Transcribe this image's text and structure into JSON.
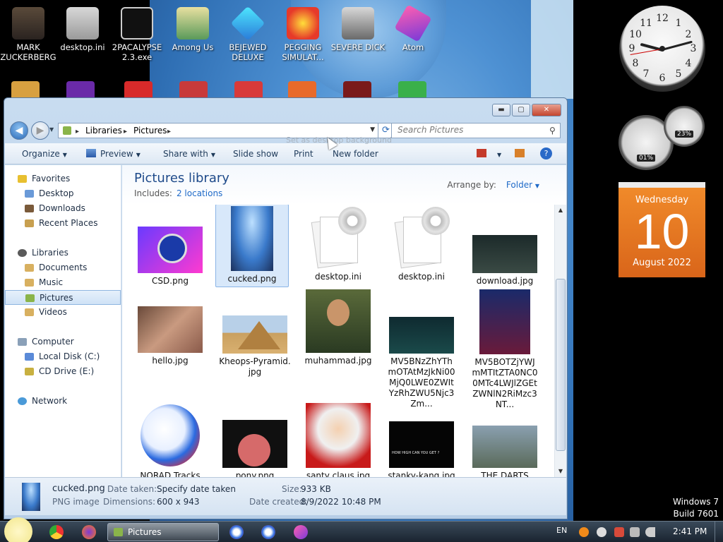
{
  "desktop": {
    "icons": [
      {
        "label": "MARK ZUCKERBERG"
      },
      {
        "label": "desktop.ini"
      },
      {
        "label": "2PACALYPSE 2.3.exe"
      },
      {
        "label": "Among Us"
      },
      {
        "label": "BEJEWED DELUXE"
      },
      {
        "label": "PEGGING SIMULAT..."
      },
      {
        "label": "SEVERE DICK"
      },
      {
        "label": "Atom"
      }
    ],
    "clock_numbers": [
      "12",
      "1",
      "2",
      "3",
      "4",
      "5",
      "6",
      "7",
      "8",
      "9",
      "10",
      "11"
    ],
    "meters": {
      "cpu": "01%",
      "memory": "23%"
    },
    "calendar": {
      "weekday": "Wednesday",
      "day": "10",
      "month_year": "August 2022"
    },
    "os": {
      "line1": "Windows 7",
      "line2": "Build 7601"
    }
  },
  "window": {
    "controls": {
      "minimize": "▬",
      "maximize": "▢",
      "close": "✕"
    },
    "breadcrumb": [
      "Libraries",
      "Pictures"
    ],
    "search_placeholder": "Search Pictures",
    "ghost_tooltip": "Set as desktop background",
    "toolbar": {
      "organize": "Organize",
      "preview": "Preview",
      "share_with": "Share with",
      "slide_show": "Slide show",
      "print": "Print",
      "new_folder": "New folder"
    },
    "sidebar": {
      "favorites": "Favorites",
      "desktop": "Desktop",
      "downloads": "Downloads",
      "recent_places": "Recent Places",
      "libraries": "Libraries",
      "documents": "Documents",
      "music": "Music",
      "pictures": "Pictures",
      "videos": "Videos",
      "computer": "Computer",
      "local_disk": "Local Disk (C:)",
      "cd_drive": "CD Drive (E:)",
      "network": "Network"
    },
    "library": {
      "title": "Pictures library",
      "includes_label": "Includes:",
      "includes_link": "2 locations",
      "arrange_label": "Arrange by:",
      "arrange_value": "Folder"
    },
    "files": [
      "CSD.png",
      "cucked.png",
      "desktop.ini",
      "desktop.ini",
      "download.jpg",
      "hello.jpg",
      "Kheops-Pyramid.jpg",
      "muhammad.jpg",
      "MV5BNzZhYThmOTAtMzJkNi00MjQ0LWE0ZWItYzRhZWU5Njc3Zm...",
      "MV5BOTZjYWJmMTItZTA0NC00MTc4LWJlZGEtZWNlN2RiMzc3NT...",
      "NORAD Tracks",
      "pony.png",
      "santy claus.jpg",
      "stanky-kang.jpg",
      "THE DARTS"
    ],
    "details": {
      "name": "cucked.png",
      "type": "PNG image",
      "date_taken_label": "Date taken:",
      "date_taken_value": "Specify date taken",
      "dimensions_label": "Dimensions:",
      "dimensions_value": "600 x 943",
      "size_label": "Size:",
      "size_value": "933 KB",
      "date_created_label": "Date created:",
      "date_created_value": "8/9/2022 10:48 PM"
    }
  },
  "taskbar": {
    "active_window": "Pictures",
    "language": "EN",
    "time": "2:41 PM"
  }
}
